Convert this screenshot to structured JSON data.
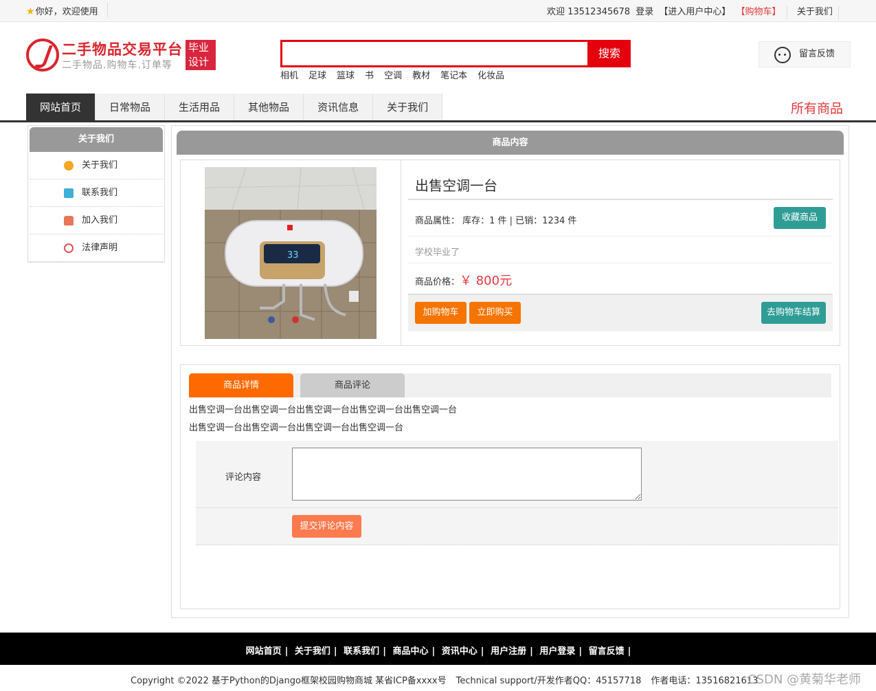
{
  "topbar": {
    "greeting": "你好，欢迎使用",
    "welcome_user": "欢迎 13512345678",
    "login": "登录",
    "user_center": "【进入用户中心】",
    "cart": "【购物车】",
    "about": "关于我们"
  },
  "header": {
    "site_title": "二手物品交易平台",
    "site_subtitle": "二手物品.购物车.订单等",
    "badge_line1": "毕业",
    "badge_line2": "设计",
    "search_placeholder": "",
    "search_button": "搜索",
    "hot_words": [
      "相机",
      "足球",
      "篮球",
      "书",
      "空调",
      "教材",
      "笔记本",
      "化妆品"
    ],
    "feedback_label": "留言反馈"
  },
  "nav": {
    "items": [
      "网站首页",
      "日常物品",
      "生活用品",
      "其他物品",
      "资讯信息",
      "关于我们"
    ],
    "active_index": 0,
    "all_goods": "所有商品"
  },
  "sidebar": {
    "title": "关于我们",
    "items": [
      {
        "label": "关于我们",
        "icon": "about-icon"
      },
      {
        "label": "联系我们",
        "icon": "contact-icon"
      },
      {
        "label": "加入我们",
        "icon": "lock-icon"
      },
      {
        "label": "法律声明",
        "icon": "power-icon"
      }
    ]
  },
  "product": {
    "section_title": "商品内容",
    "title": "出售空调一台",
    "attributes": "商品属性：  库存：1 件 | 已销：1234 件",
    "description": "学校毕业了",
    "price_label": "商品价格：",
    "price": "￥ 800元",
    "favorite_button": "收藏商品",
    "add_cart_button": "加购物车",
    "buy_now_button": "立即购买",
    "checkout_button": "去购物车结算",
    "image_display": "33"
  },
  "detail": {
    "tab_detail": "商品详情",
    "tab_comment": "商品评论",
    "text_line1": "出售空调一台出售空调一台出售空调一台出售空调一台出售空调一台",
    "text_line2": "出售空调一台出售空调一台出售空调一台出售空调一台",
    "comment_label": "评论内容",
    "comment_value": "",
    "submit_button": "提交评论内容"
  },
  "footer": {
    "links": [
      "网站首页",
      "关于我们",
      "联系我们",
      "商品中心",
      "资讯中心",
      "用户注册",
      "用户登录",
      "留言反馈"
    ],
    "copyright": "Copyright ©2022 基于Python的Django框架校园购物商城 某省ICP备xxxx号",
    "support": "Technical support/开发作者QQ：45157718",
    "phone": "作者电话：13516821613",
    "watermark": "CSDN @黄菊华老师"
  },
  "colors": {
    "brand_red": "#d8262d",
    "search_red": "#e4010d",
    "orange": "#f57402",
    "teal": "#2f9d95",
    "price_red": "#e4393c"
  }
}
